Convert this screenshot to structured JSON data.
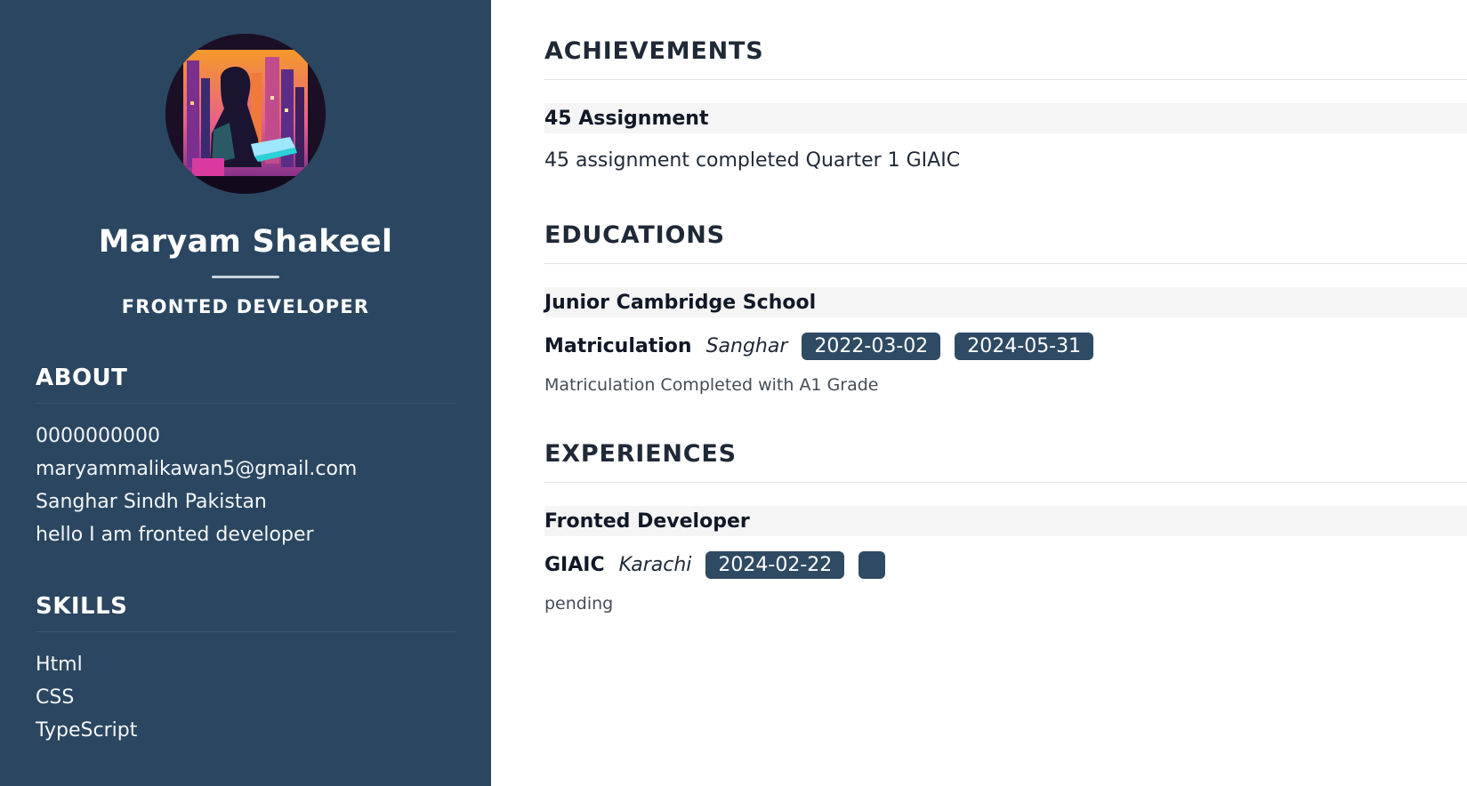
{
  "profile": {
    "name": "Maryam Shakeel",
    "role": "FRONTED DEVELOPER"
  },
  "about": {
    "heading": "ABOUT",
    "phone": "0000000000",
    "email": "maryammalikawan5@gmail.com",
    "location": "Sanghar Sindh Pakistan",
    "bio": "hello I am fronted developer"
  },
  "skills": {
    "heading": "SKILLS",
    "items": [
      "Html",
      "CSS",
      "TypeScript"
    ]
  },
  "achievements": {
    "heading": "ACHIEVEMENTS",
    "items": [
      {
        "title": "45 Assignment",
        "description": "45 assignment completed Quarter 1 GIAIC"
      }
    ]
  },
  "educations": {
    "heading": "EDUCATIONS",
    "items": [
      {
        "school": "Junior Cambridge School",
        "degree": "Matriculation",
        "location": "Sanghar",
        "start": "2022-03-02",
        "end": "2024-05-31",
        "note": "Matriculation Completed with A1 Grade"
      }
    ]
  },
  "experiences": {
    "heading": "EXPERIENCES",
    "items": [
      {
        "title": "Fronted Developer",
        "company": "GIAIC",
        "location": "Karachi",
        "start": "2024-02-22",
        "end": "",
        "note": "pending"
      }
    ]
  },
  "colors": {
    "sidebar": "#2b4660",
    "badge": "#2f4a63"
  }
}
